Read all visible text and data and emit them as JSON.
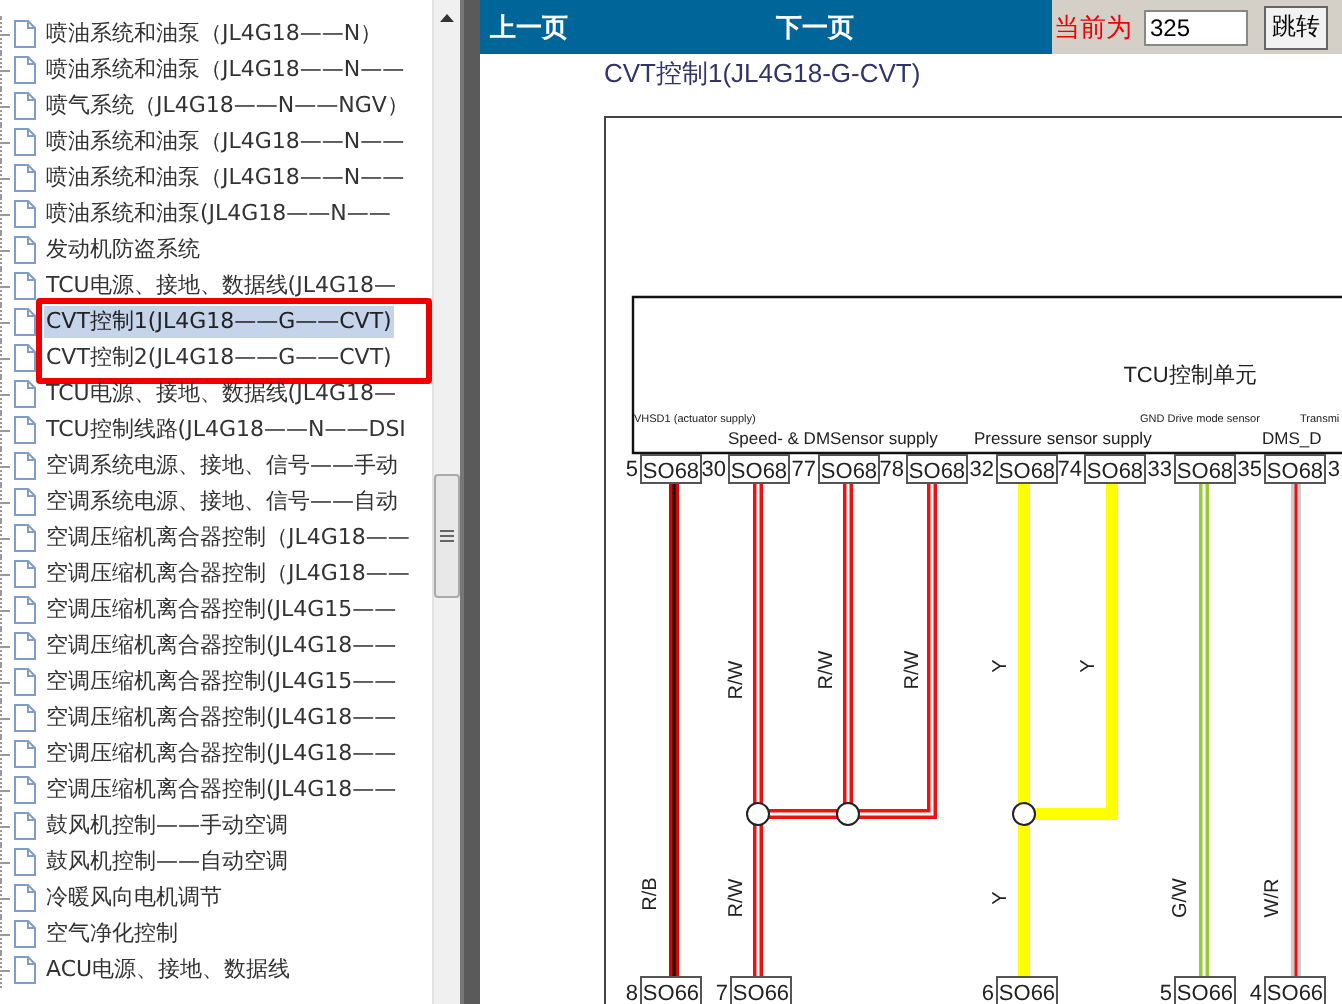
{
  "tree": {
    "items": [
      {
        "label": "喷油系统和油泵（JL4G18——N）",
        "selected": false,
        "highlighted": false
      },
      {
        "label": "喷油系统和油泵（JL4G18——N——",
        "selected": false,
        "highlighted": false
      },
      {
        "label": "喷气系统（JL4G18——N——NGV）",
        "selected": false,
        "highlighted": false
      },
      {
        "label": "喷油系统和油泵（JL4G18——N——",
        "selected": false,
        "highlighted": false
      },
      {
        "label": "喷油系统和油泵（JL4G18——N——",
        "selected": false,
        "highlighted": false
      },
      {
        "label": "喷油系统和油泵(JL4G18——N——",
        "selected": false,
        "highlighted": false
      },
      {
        "label": "发动机防盗系统",
        "selected": false,
        "highlighted": false
      },
      {
        "label": "TCU电源、接地、数据线(JL4G18—",
        "selected": false,
        "highlighted": false
      },
      {
        "label": "CVT控制1(JL4G18——G——CVT)",
        "selected": true,
        "highlighted": true
      },
      {
        "label": "CVT控制2(JL4G18——G——CVT)",
        "selected": false,
        "highlighted": true
      },
      {
        "label": "TCU电源、接地、数据线(JL4G18—",
        "selected": false,
        "highlighted": false
      },
      {
        "label": "TCU控制线路(JL4G18——N——DSI",
        "selected": false,
        "highlighted": false
      },
      {
        "label": "空调系统电源、接地、信号——手动",
        "selected": false,
        "highlighted": false
      },
      {
        "label": "空调系统电源、接地、信号——自动",
        "selected": false,
        "highlighted": false
      },
      {
        "label": "空调压缩机离合器控制（JL4G18——",
        "selected": false,
        "highlighted": false
      },
      {
        "label": "空调压缩机离合器控制（JL4G18——",
        "selected": false,
        "highlighted": false
      },
      {
        "label": "空调压缩机离合器控制(JL4G15——",
        "selected": false,
        "highlighted": false
      },
      {
        "label": "空调压缩机离合器控制(JL4G18——",
        "selected": false,
        "highlighted": false
      },
      {
        "label": "空调压缩机离合器控制(JL4G15——",
        "selected": false,
        "highlighted": false
      },
      {
        "label": "空调压缩机离合器控制(JL4G18——",
        "selected": false,
        "highlighted": false
      },
      {
        "label": "空调压缩机离合器控制(JL4G18——",
        "selected": false,
        "highlighted": false
      },
      {
        "label": "空调压缩机离合器控制(JL4G18——",
        "selected": false,
        "highlighted": false
      },
      {
        "label": "鼓风机控制——手动空调",
        "selected": false,
        "highlighted": false
      },
      {
        "label": "鼓风机控制——自动空调",
        "selected": false,
        "highlighted": false
      },
      {
        "label": "冷暖风向电机调节",
        "selected": false,
        "highlighted": false
      },
      {
        "label": "空气净化控制",
        "selected": false,
        "highlighted": false
      },
      {
        "label": "ACU电源、接地、数据线",
        "selected": false
      }
    ]
  },
  "nav": {
    "prev": "上一页",
    "next": "下一页",
    "current_label": "当前为",
    "page_value": "325",
    "go_button": "跳转"
  },
  "page_title": "CVT控制1(JL4G18-G-CVT)",
  "diagram": {
    "unit_label": "TCU控制单元",
    "notes": [
      "VHSD1 (actuator supply)",
      "GND Drive mode sensor",
      "Transmi"
    ],
    "group_labels": [
      "Speed- & DMSensor supply",
      "Pressure sensor supply",
      "DMS_D"
    ],
    "top_pins": [
      {
        "number": "5",
        "connector": "SO68"
      },
      {
        "number": "30",
        "connector": "SO68"
      },
      {
        "number": "77",
        "connector": "SO68"
      },
      {
        "number": "78",
        "connector": "SO68"
      },
      {
        "number": "32",
        "connector": "SO68"
      },
      {
        "number": "74",
        "connector": "SO68"
      },
      {
        "number": "33",
        "connector": "SO68"
      },
      {
        "number": "35",
        "connector": "SO68"
      },
      {
        "number": "3"
      }
    ],
    "wires": [
      {
        "labels": [
          "R/B"
        ],
        "kind": "redblack"
      },
      {
        "labels": [
          "R/W",
          "R/W"
        ],
        "kind": "redwhite"
      },
      {
        "labels": [
          "R/W"
        ],
        "kind": "redwhite"
      },
      {
        "labels": [
          "R/W"
        ],
        "kind": "redwhite"
      },
      {
        "labels": [
          "Y",
          "Y"
        ],
        "kind": "yellow"
      },
      {
        "labels": [
          "Y"
        ],
        "kind": "yellow"
      },
      {
        "labels": [
          "G/W"
        ],
        "kind": "greenwhite"
      },
      {
        "labels": [
          "W/R"
        ],
        "kind": "whitered"
      }
    ],
    "bottom_pins": [
      {
        "number": "8",
        "connector": "SO66"
      },
      {
        "number": "7",
        "connector": "SO66"
      },
      {
        "number": "6",
        "connector": "SO66"
      },
      {
        "number": "5",
        "connector": "SO66"
      },
      {
        "number": "4",
        "connector": "SO66"
      }
    ]
  }
}
